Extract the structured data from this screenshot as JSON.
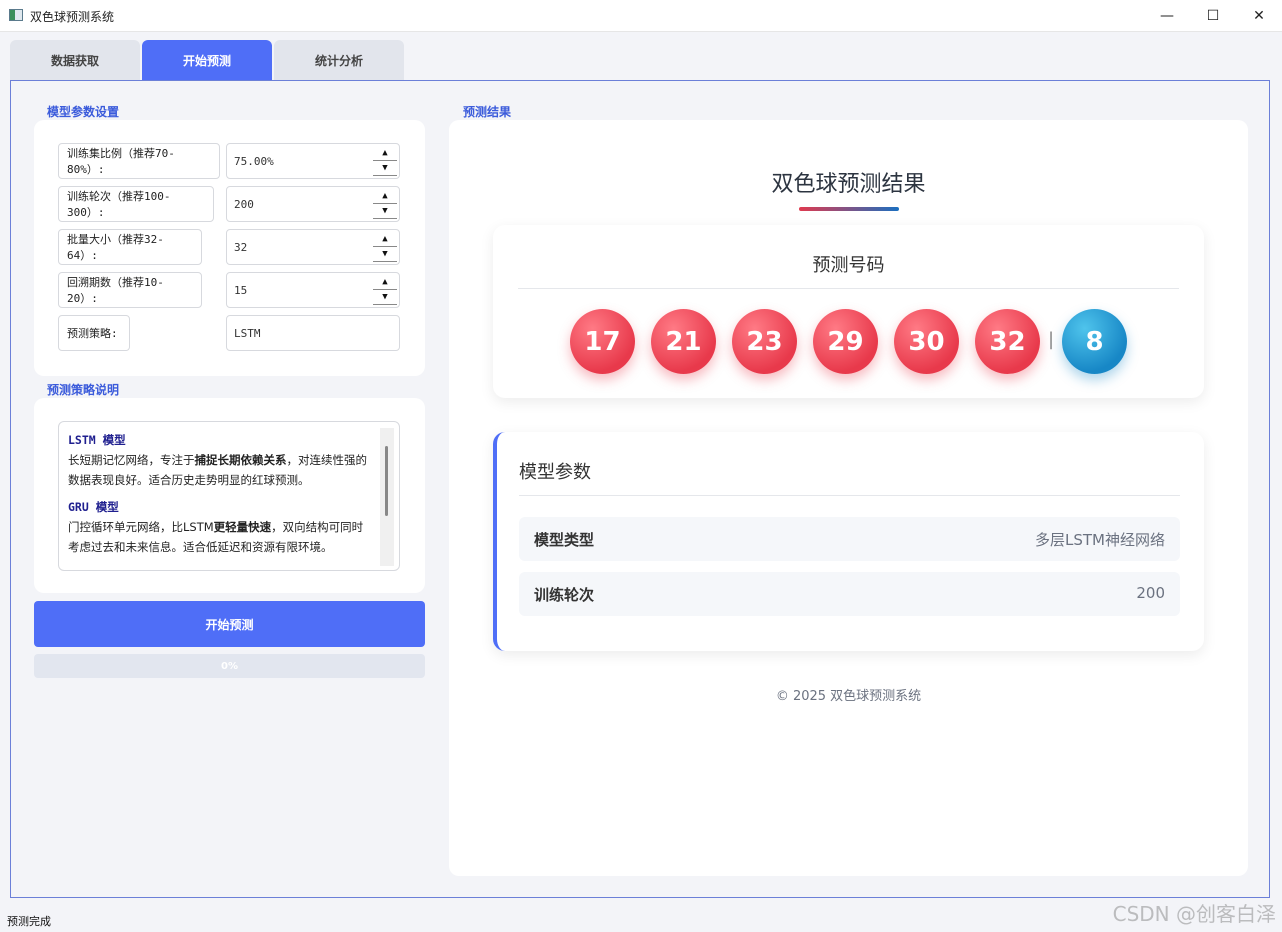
{
  "window": {
    "title": "双色球预测系统",
    "controls": {
      "minimize": "—",
      "maximize": "☐",
      "close": "✕"
    }
  },
  "tabs": [
    {
      "label": "数据获取",
      "active": false
    },
    {
      "label": "开始预测",
      "active": true
    },
    {
      "label": "统计分析",
      "active": false
    }
  ],
  "left": {
    "params_heading": "模型参数设置",
    "params": [
      {
        "label": "训练集比例（推荐70-80%）:",
        "value": "75.00%",
        "spin": true
      },
      {
        "label": "训练轮次（推荐100-300）:",
        "value": "200",
        "spin": true
      },
      {
        "label": "批量大小（推荐32-64）:",
        "value": "32",
        "spin": true
      },
      {
        "label": "回溯期数（推荐10-20）:",
        "value": "15",
        "spin": true
      },
      {
        "label": "预测策略:",
        "value": "LSTM",
        "spin": false
      }
    ],
    "strategy_heading": "预测策略说明",
    "strategies": [
      {
        "title": "LSTM 模型",
        "pre": "长短期记忆网络，专注于",
        "bold": "捕捉长期依赖关系",
        "post": "，对连续性强的数据表现良好。适合历史走势明显的红球预测。"
      },
      {
        "title": "GRU 模型",
        "pre": "门控循环单元网络，比LSTM",
        "bold": "更轻量快速",
        "post": "，双向结构可同时考虑过去和未来信息。适合低延迟和资源有限环境。"
      }
    ],
    "start_button": "开始预测",
    "progress": {
      "value": 0,
      "label": "0%"
    }
  },
  "right": {
    "section_heading": "预测结果",
    "title": "双色球预测结果",
    "balls_heading": "预测号码",
    "red_balls": [
      "17",
      "21",
      "23",
      "29",
      "30",
      "32"
    ],
    "separator": "|",
    "blue_ball": "8",
    "model_heading": "模型参数",
    "model_rows": [
      {
        "key": "模型类型",
        "value": "多层LSTM神经网络"
      },
      {
        "key": "训练轮次",
        "value": "200"
      }
    ],
    "footer": "© 2025 双色球预测系统"
  },
  "status_bar": "预测完成",
  "watermark": "CSDN @创客白泽",
  "colors": {
    "accent": "#4f6ef7",
    "red_ball": "#e8394b",
    "blue_ball": "#1787c6"
  }
}
